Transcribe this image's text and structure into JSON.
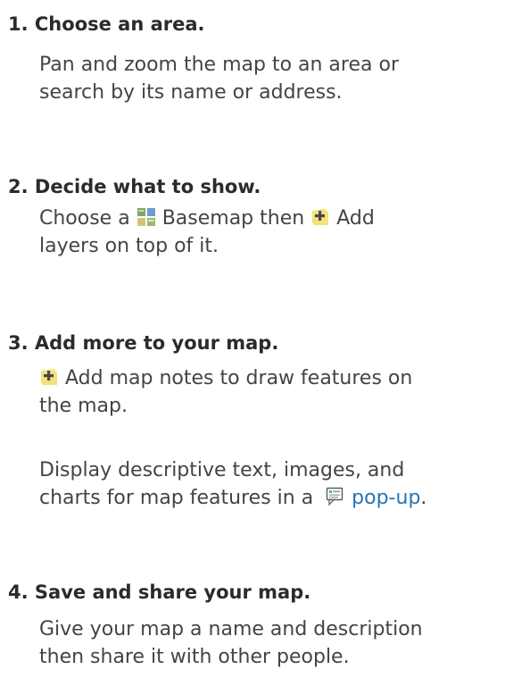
{
  "steps": [
    {
      "title": "1. Choose an area.",
      "lines": [
        "Pan and zoom the map to an area or",
        "search by its name or address."
      ]
    },
    {
      "title": "2. Decide what to show.",
      "line1": {
        "a": "Choose a ",
        "basemap_label": "Basemap",
        "b": " then ",
        "add_label": "Add"
      },
      "line2": "layers on top of it."
    },
    {
      "title": "3. Add more to your map.",
      "para1": {
        "line1": "Add map notes to draw features on",
        "line2": "the map."
      },
      "para2": {
        "line1": "Display descriptive text, images, and",
        "line2_text": "charts for map features in a ",
        "link": "pop-up",
        "end": "."
      }
    },
    {
      "title": "4. Save and share your map.",
      "lines": [
        "Give your map a name and description",
        "then share it with other people."
      ]
    }
  ],
  "icons": {
    "basemap": "basemap-grid-icon",
    "add": "add-layer-icon",
    "popup": "popup-icon"
  },
  "colors": {
    "link": "#2b71b8",
    "add_icon_fill": "#f3e27a",
    "add_icon_plus": "#4a4a4a"
  }
}
